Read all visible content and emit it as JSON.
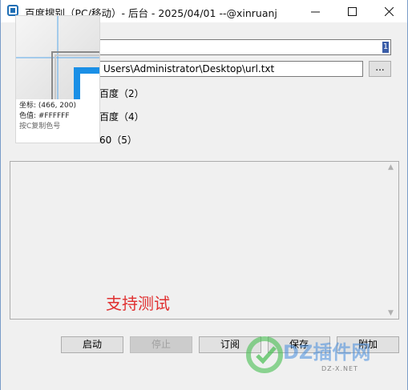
{
  "window": {
    "title": "百度搜别（PC/移动）- 后台 - 2025/04/01 --@xinruanj",
    "min_label": "—",
    "max_label": "☐",
    "close_label": "✕"
  },
  "top": {
    "field1_value": "",
    "field1_marker": "1",
    "path_value": "Users\\Administrator\\Desktop\\url.txt",
    "browse_label": "..."
  },
  "options": [
    {
      "label": "百度（2）"
    },
    {
      "label": "百度（4）"
    },
    {
      "label": "60（5）"
    }
  ],
  "magnifier": {
    "coord_label": "坐标: (466, 200)",
    "color_label": "色值: #FFFFFF",
    "hint_label": "按C复制色号",
    "accent_color": "#1a8fe6"
  },
  "main": {
    "overlay_text": "支持测试"
  },
  "buttons": {
    "start_label": "启动",
    "stop_label": "停止",
    "subscribe_label": "订阅",
    "save_label": "保存",
    "append_label": "附加"
  },
  "watermark": {
    "logo_text": "DZ插件网",
    "sub_text": "DZ-X.NET"
  }
}
